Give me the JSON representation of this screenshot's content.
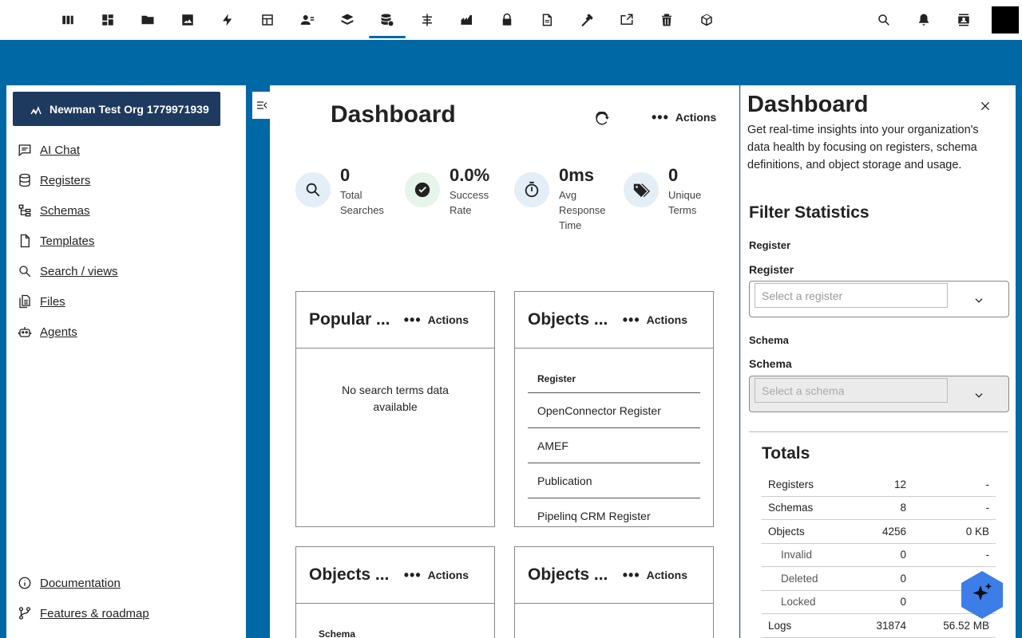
{
  "topbar": {
    "apps": [
      {
        "name": "app-icon-library"
      },
      {
        "name": "app-icon-dashboard"
      },
      {
        "name": "app-icon-files"
      },
      {
        "name": "app-icon-photos"
      },
      {
        "name": "app-icon-activity"
      },
      {
        "name": "app-icon-tables"
      },
      {
        "name": "app-icon-contacts"
      },
      {
        "name": "app-icon-layers"
      },
      {
        "name": "app-icon-openregister"
      },
      {
        "name": "app-icon-connector"
      },
      {
        "name": "app-icon-catalog"
      },
      {
        "name": "app-icon-passwords"
      },
      {
        "name": "app-icon-documents"
      },
      {
        "name": "app-icon-decisions"
      },
      {
        "name": "app-icon-integration"
      },
      {
        "name": "app-icon-archive"
      },
      {
        "name": "app-icon-package"
      }
    ],
    "active_app": "app-icon-openregister"
  },
  "leftnav": {
    "org": "Newman Test Org 1779971939",
    "items": [
      {
        "label": "AI Chat",
        "icon": "chat-icon"
      },
      {
        "label": "Registers",
        "icon": "database-icon"
      },
      {
        "label": "Schemas",
        "icon": "schema-icon"
      },
      {
        "label": "Templates",
        "icon": "file-icon"
      },
      {
        "label": "Search / views",
        "icon": "search-icon"
      },
      {
        "label": "Files",
        "icon": "files-icon"
      },
      {
        "label": "Agents",
        "icon": "robot-icon"
      }
    ],
    "bottom": [
      {
        "label": "Documentation",
        "icon": "info-icon"
      },
      {
        "label": "Features & roadmap",
        "icon": "roadmap-icon"
      }
    ]
  },
  "main": {
    "title": "Dashboard",
    "actions_label": "Actions",
    "stats": [
      {
        "value": "0",
        "label": "Total Searches",
        "icon": "search-icon",
        "color": "#e3eef7"
      },
      {
        "value": "0.0%",
        "label": "Success Rate",
        "icon": "check-circle-icon",
        "color": "#e6f4ea"
      },
      {
        "value": "0ms",
        "label": "Avg Response Time",
        "icon": "timer-icon",
        "color": "#e3eef7"
      },
      {
        "value": "0",
        "label": "Unique Terms",
        "icon": "tags-icon",
        "color": "#e3eef7"
      }
    ],
    "cards": {
      "popular": {
        "title": "Popular ...",
        "actions": "Actions",
        "empty": "No search terms data available"
      },
      "objects_register": {
        "title": "Objects ...",
        "actions": "Actions",
        "col": "Register",
        "rows": [
          "OpenConnector Register",
          "AMEF",
          "Publication",
          "Pipelinq CRM Register"
        ]
      },
      "objects_schema": {
        "title": "Objects ...",
        "actions": "Actions",
        "col": "Schema"
      },
      "objects_other": {
        "title": "Objects ...",
        "actions": "Actions"
      }
    }
  },
  "rpanel": {
    "title": "Dashboard",
    "description": "Get real-time insights into your organization's data health by focusing on registers, schema definitions, and object storage and usage.",
    "filter_title": "Filter Statistics",
    "register_small": "Register",
    "register_label": "Register",
    "register_placeholder": "Select a register",
    "schema_small": "Schema",
    "schema_label": "Schema",
    "schema_placeholder": "Select a schema",
    "totals_title": "Totals",
    "totals": [
      {
        "name": "Registers",
        "count": "12",
        "size": "-",
        "sub": false
      },
      {
        "name": "Schemas",
        "count": "8",
        "size": "-",
        "sub": false
      },
      {
        "name": "Objects",
        "count": "4256",
        "size": "0 KB",
        "sub": false
      },
      {
        "name": "Invalid",
        "count": "0",
        "size": "-",
        "sub": true
      },
      {
        "name": "Deleted",
        "count": "0",
        "size": "",
        "sub": true
      },
      {
        "name": "Locked",
        "count": "0",
        "size": "",
        "sub": true
      },
      {
        "name": "Logs",
        "count": "31874",
        "size": "56.52 MB",
        "sub": false
      }
    ]
  },
  "colors": {
    "brand": "#0068a5",
    "org_button": "#1e3a5f",
    "ai_fab": "#3d7de8"
  }
}
